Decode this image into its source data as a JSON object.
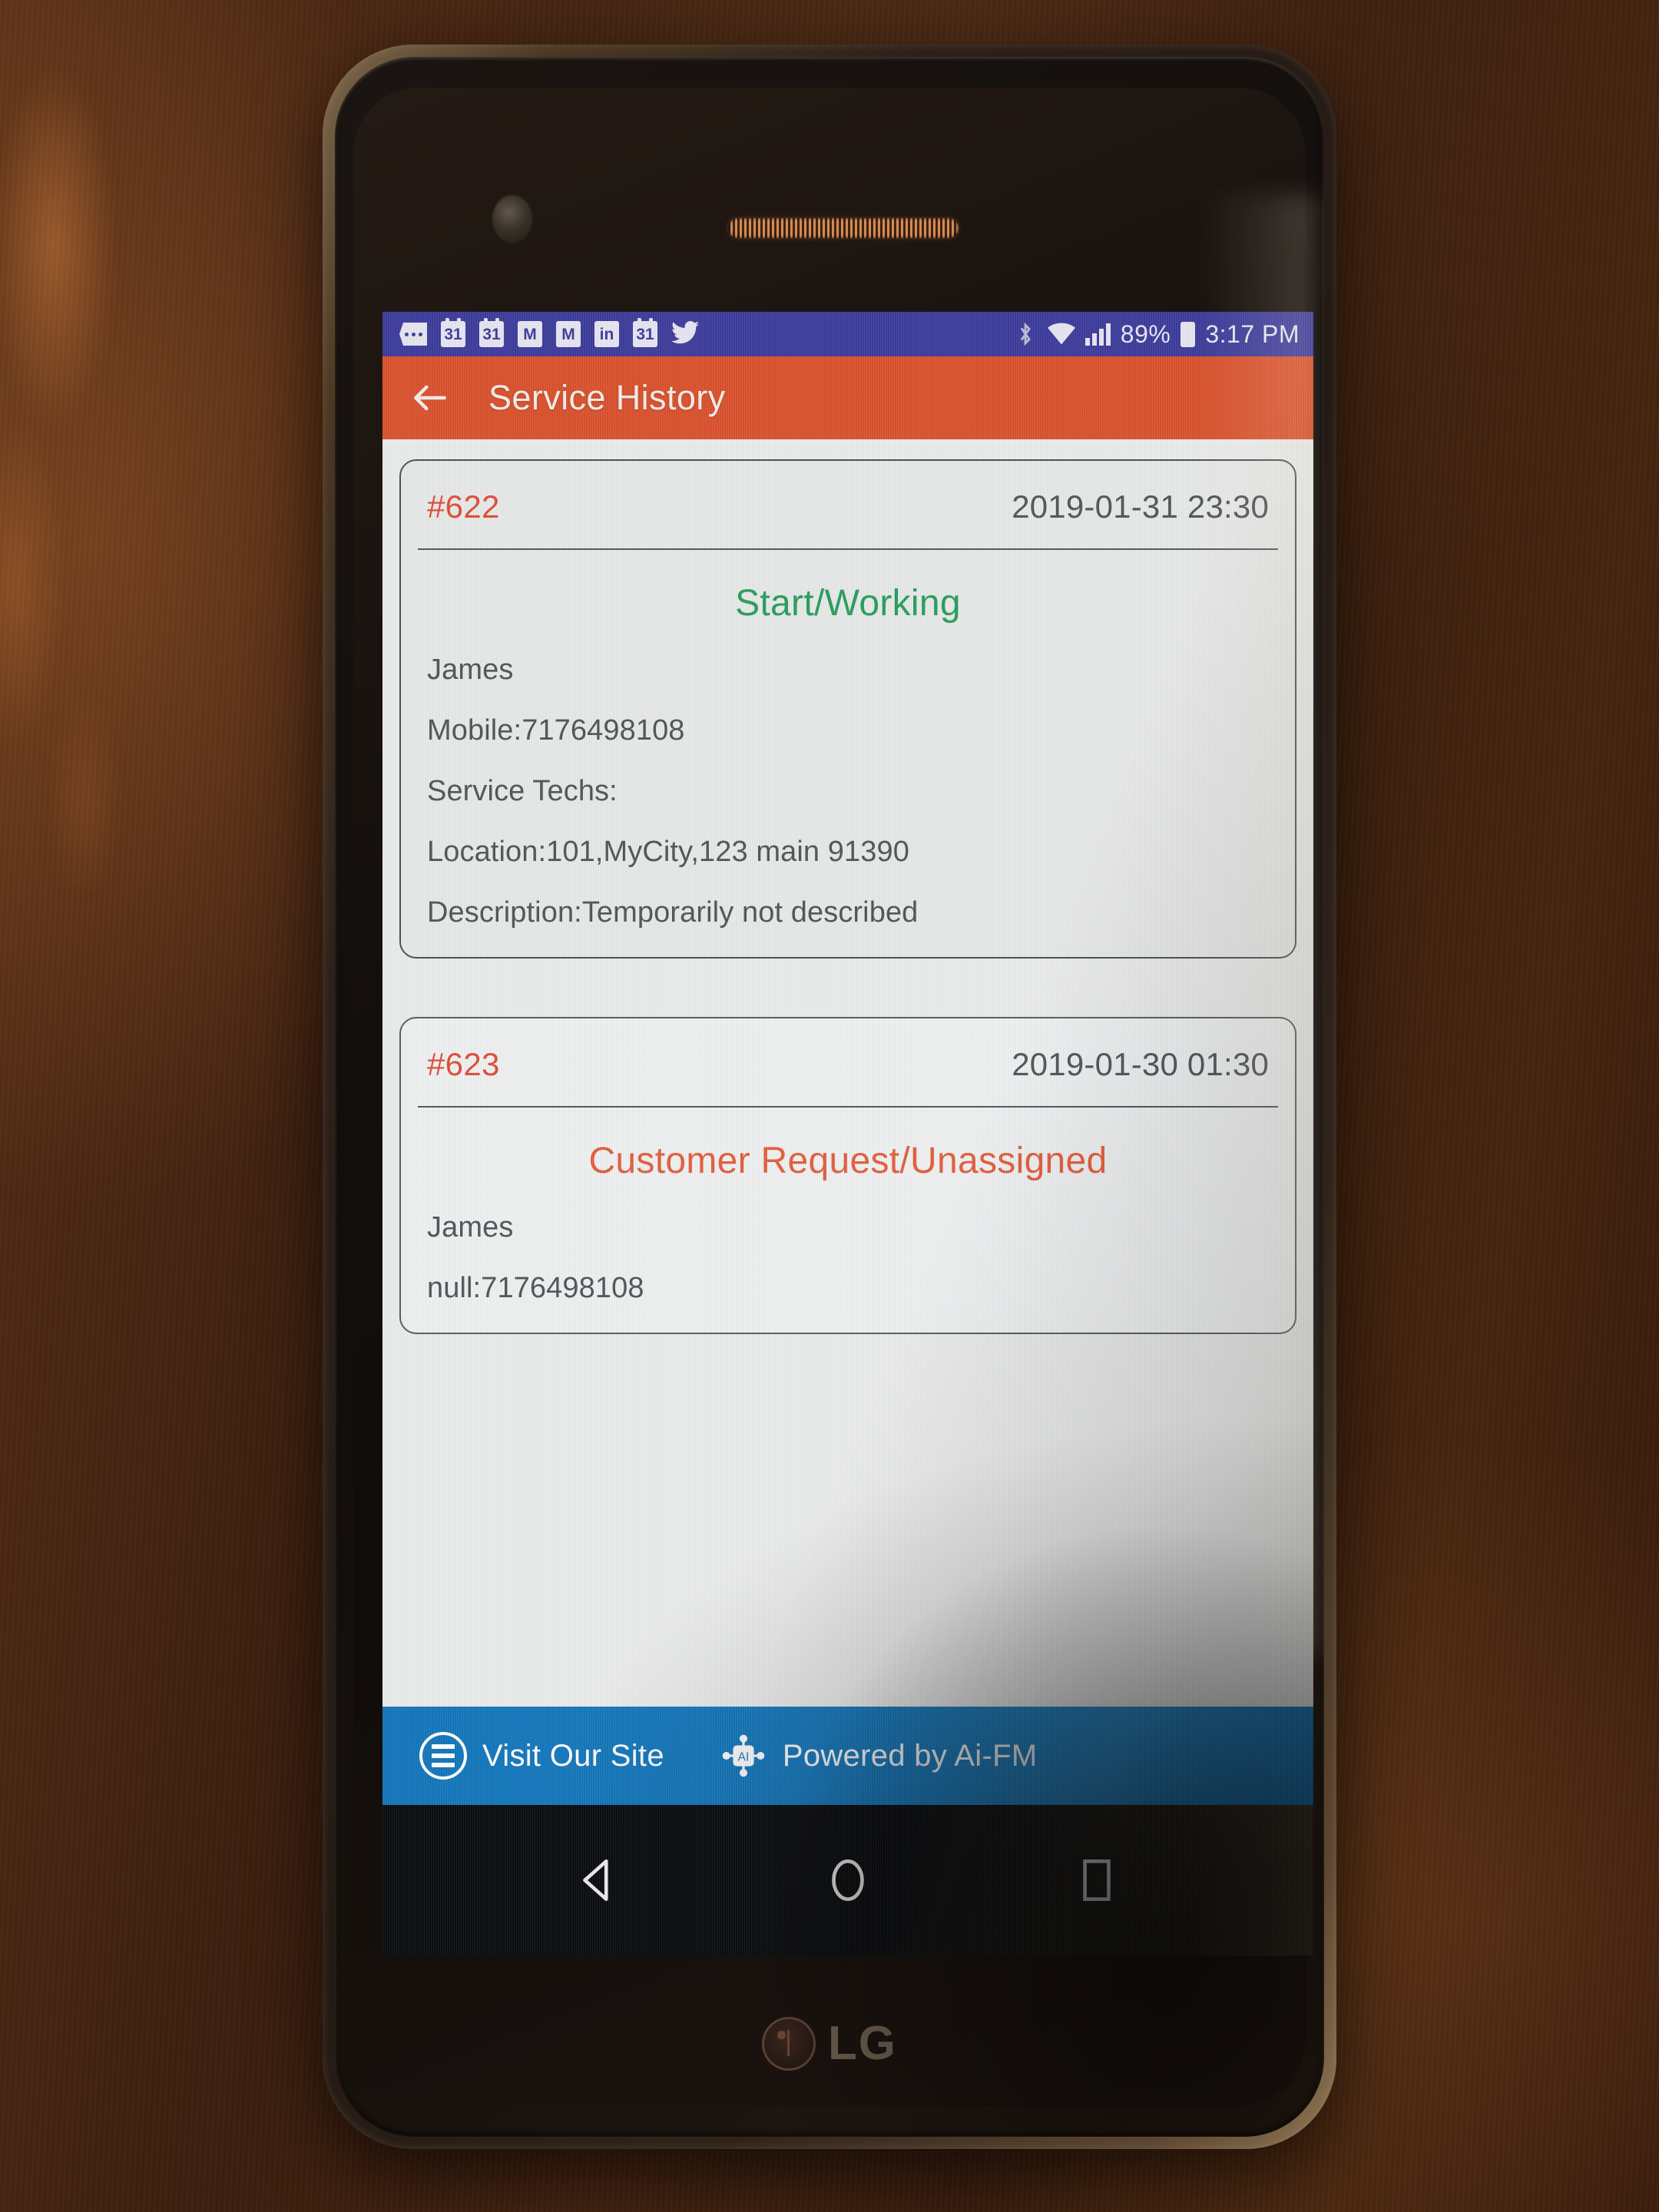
{
  "device": {
    "brand": "LG",
    "camera_icon": "front-camera",
    "earpiece_icon": "earpiece-speaker"
  },
  "status_bar": {
    "background_color": "#3f3e9d",
    "notification_icons": [
      {
        "name": "more-notifications-icon",
        "label": ""
      },
      {
        "name": "calendar-icon",
        "label": "31"
      },
      {
        "name": "calendar-icon",
        "label": "31"
      },
      {
        "name": "gmail-icon",
        "label": "M"
      },
      {
        "name": "gmail-icon",
        "label": "M"
      },
      {
        "name": "linkedin-icon",
        "label": "in"
      },
      {
        "name": "calendar-icon",
        "label": "31"
      },
      {
        "name": "twitter-icon",
        "label": ""
      }
    ],
    "bluetooth_icon": "bluetooth-icon",
    "wifi_icon": "wifi-icon",
    "signal_icon": "cellular-signal-icon",
    "battery_percent": "89%",
    "battery_icon": "battery-icon",
    "clock": "3:17 PM"
  },
  "app_bar": {
    "back_icon": "back-arrow-icon",
    "title": "Service History",
    "background_color": "#dc5430",
    "title_color": "#f6eeea"
  },
  "service_history": {
    "cards": [
      {
        "id": "#622",
        "timestamp": "2019-01-31 23:30",
        "status": "Start/Working",
        "status_color": "#29a05e",
        "lines": [
          "James",
          "Mobile:7176498108",
          "Service Techs:",
          "Location:101,MyCity,123 main 91390",
          "Description:Temporarily not described"
        ]
      },
      {
        "id": "#623",
        "timestamp": "2019-01-30 01:30",
        "status": "Customer Request/Unassigned",
        "status_color": "#e5603f",
        "lines": [
          "James",
          "null:7176498108"
        ]
      }
    ],
    "id_color": "#e0503a",
    "date_color": "#53585a"
  },
  "footer": {
    "background_color": "#1a7cc0",
    "site_icon": "hamburger-menu-circle-icon",
    "site_label": "Visit Our Site",
    "ai_icon": "ai-chip-icon",
    "powered_label": "Powered by Ai-FM"
  },
  "nav_bar": {
    "back_icon": "android-back-triangle-icon",
    "home_icon": "android-home-circle-icon",
    "recents_icon": "android-recents-square-icon"
  }
}
